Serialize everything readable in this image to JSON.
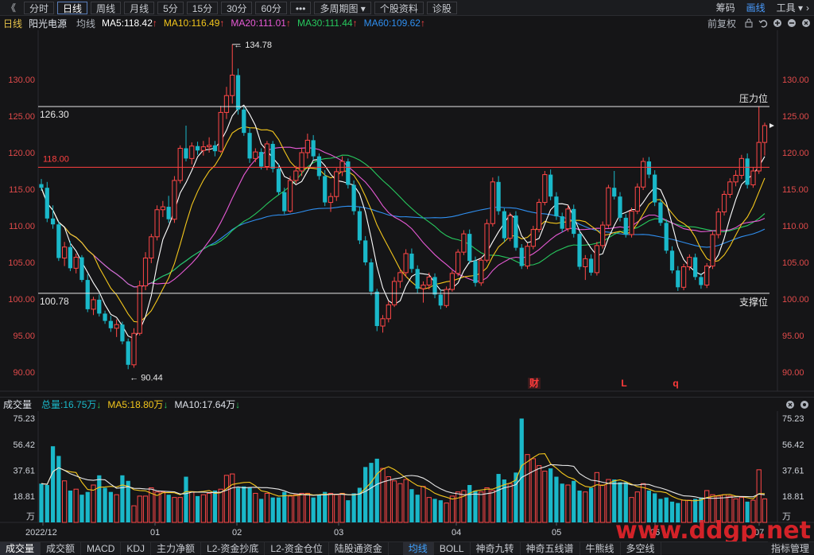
{
  "toolbar": {
    "back": "《",
    "periods": [
      "分时",
      "日线",
      "周线",
      "月线",
      "5分",
      "15分",
      "30分",
      "60分",
      "•••",
      "多周期图 ▾",
      "个股资料",
      "诊股"
    ],
    "active_period": "日线",
    "right": [
      "筹码",
      "画线",
      "工具 ▾"
    ],
    "active_right": "画线"
  },
  "info": {
    "period": "日线",
    "stock_name": "阳光电源",
    "ma_type": "均线",
    "ma5": "MA5:118.42",
    "ma10": "MA10:116.49",
    "ma20": "MA20:111.01",
    "ma30": "MA30:111.44",
    "ma60": "MA60:109.62",
    "adjust": "前复权",
    "ma_colors": {
      "ma5": "#ffffff",
      "ma10": "#f3c61c",
      "ma20": "#e85ad6",
      "ma30": "#27c95e",
      "ma60": "#2f8ff0"
    }
  },
  "price_axis": {
    "labels": [
      "130.00",
      "125.00",
      "120.00",
      "115.00",
      "110.00",
      "105.00",
      "100.00",
      "95.00",
      "90.00"
    ],
    "max_label": "134.78",
    "min_label": "90.44",
    "resistance_value": "126.30",
    "resistance_label": "压力位",
    "support_value": "100.78",
    "support_label": "支撑位",
    "ref_line_value": "118.00",
    "events": [
      "财",
      "L",
      "q"
    ]
  },
  "volume": {
    "title": "成交量",
    "total": "总量:16.75万",
    "ma5": "MA5:18.80万",
    "ma10": "MA10:17.64万",
    "axis_labels": [
      "75.23",
      "56.42",
      "37.61",
      "18.81",
      "万"
    ]
  },
  "date_axis": [
    "2022/12",
    "01",
    "02",
    "03",
    "04",
    "05",
    "06",
    "07"
  ],
  "bottom_tabs": [
    "成交量",
    "成交额",
    "MACD",
    "KDJ",
    "主力净额",
    "L2-资金抄底",
    "L2-资金仓位",
    "陆股通资金",
    "均线",
    "BOLL",
    "神奇九转",
    "神奇五线谱",
    "牛熊线",
    "多空线"
  ],
  "bottom_active": [
    "成交量",
    "均线"
  ],
  "bottom_right": "指标管理",
  "watermark": "www.ddgp.net",
  "colors": {
    "up": "#ff4747",
    "down": "#1ab8c9",
    "grid": "#2b2c30",
    "axis": "#8a8f98"
  },
  "chart_data": {
    "type": "candlestick",
    "title": "阳光电源",
    "y_range": [
      88,
      136
    ],
    "candles": [
      [
        115.7,
        116.4,
        114.8,
        115.2
      ],
      [
        115.2,
        116.0,
        110.5,
        111.0
      ],
      [
        111.0,
        112.8,
        109.6,
        110.2
      ],
      [
        110.2,
        110.6,
        105.2,
        105.6
      ],
      [
        105.6,
        107.8,
        104.5,
        107.1
      ],
      [
        107.1,
        107.9,
        103.8,
        104.2
      ],
      [
        104.2,
        106.2,
        103.5,
        105.7
      ],
      [
        105.7,
        106.0,
        102.3,
        102.6
      ],
      [
        102.6,
        103.4,
        98.2,
        98.6
      ],
      [
        98.6,
        100.3,
        97.8,
        99.9
      ],
      [
        99.9,
        100.6,
        97.6,
        98.0
      ],
      [
        98.0,
        98.4,
        96.6,
        97.0
      ],
      [
        97.0,
        97.7,
        95.5,
        96.0
      ],
      [
        96.0,
        97.2,
        94.8,
        96.5
      ],
      [
        96.5,
        96.9,
        93.8,
        94.2
      ],
      [
        94.2,
        94.6,
        90.4,
        91.0
      ],
      [
        91.0,
        96.0,
        90.6,
        95.3
      ],
      [
        95.3,
        102.5,
        95.0,
        101.8
      ],
      [
        101.8,
        106.4,
        101.2,
        105.6
      ],
      [
        105.6,
        108.9,
        104.9,
        108.5
      ],
      [
        108.5,
        112.8,
        108.0,
        112.2
      ],
      [
        112.2,
        113.4,
        111.2,
        112.6
      ],
      [
        112.6,
        114.1,
        110.4,
        110.9
      ],
      [
        110.9,
        116.8,
        110.4,
        116.2
      ],
      [
        116.2,
        121.0,
        115.8,
        120.6
      ],
      [
        120.6,
        123.7,
        118.8,
        119.2
      ],
      [
        119.2,
        121.4,
        118.4,
        120.9
      ],
      [
        120.9,
        121.5,
        119.7,
        120.3
      ],
      [
        120.3,
        121.6,
        119.6,
        120.8
      ],
      [
        120.8,
        122.1,
        120.0,
        121.0
      ],
      [
        121.0,
        121.6,
        119.5,
        120.2
      ],
      [
        120.2,
        126.4,
        120.0,
        125.5
      ],
      [
        125.5,
        129.0,
        124.6,
        127.8
      ],
      [
        127.8,
        134.8,
        126.7,
        130.6
      ],
      [
        130.6,
        131.5,
        125.2,
        125.9
      ],
      [
        125.9,
        126.3,
        122.3,
        122.7
      ],
      [
        122.7,
        123.4,
        118.6,
        119.2
      ],
      [
        119.2,
        120.6,
        118.7,
        120.1
      ],
      [
        120.1,
        120.6,
        117.7,
        118.1
      ],
      [
        118.1,
        121.6,
        117.6,
        121.2
      ],
      [
        121.2,
        121.6,
        117.3,
        117.8
      ],
      [
        117.8,
        118.5,
        114.2,
        114.6
      ],
      [
        114.6,
        115.2,
        111.6,
        112.0
      ],
      [
        112.0,
        116.8,
        111.8,
        116.2
      ],
      [
        116.2,
        118.2,
        115.8,
        117.5
      ],
      [
        117.5,
        120.7,
        116.8,
        120.0
      ],
      [
        120.0,
        122.6,
        119.2,
        121.7
      ],
      [
        121.7,
        122.4,
        119.0,
        119.5
      ],
      [
        119.5,
        119.9,
        116.3,
        116.8
      ],
      [
        116.8,
        117.6,
        112.7,
        113.2
      ],
      [
        113.2,
        114.5,
        111.9,
        114.0
      ],
      [
        114.0,
        117.9,
        113.4,
        117.4
      ],
      [
        117.4,
        119.5,
        116.8,
        118.8
      ],
      [
        118.8,
        119.2,
        115.1,
        115.6
      ],
      [
        115.6,
        116.2,
        111.5,
        112.0
      ],
      [
        112.0,
        112.6,
        107.5,
        108.0
      ],
      [
        108.0,
        108.6,
        104.6,
        105.0
      ],
      [
        105.0,
        105.5,
        100.5,
        101.0
      ],
      [
        101.0,
        101.4,
        95.6,
        96.3
      ],
      [
        96.3,
        97.8,
        95.4,
        97.3
      ],
      [
        97.3,
        99.7,
        96.8,
        99.2
      ],
      [
        99.2,
        103.0,
        98.9,
        102.4
      ],
      [
        102.4,
        104.1,
        101.5,
        103.6
      ],
      [
        103.6,
        106.8,
        103.0,
        106.2
      ],
      [
        106.2,
        106.9,
        103.6,
        104.1
      ],
      [
        104.1,
        104.6,
        100.8,
        101.4
      ],
      [
        101.4,
        102.4,
        99.5,
        101.9
      ],
      [
        101.9,
        103.6,
        101.3,
        103.0
      ],
      [
        103.0,
        103.5,
        100.1,
        100.6
      ],
      [
        100.6,
        101.3,
        98.6,
        99.1
      ],
      [
        99.1,
        101.7,
        98.8,
        101.3
      ],
      [
        101.3,
        103.9,
        101.0,
        103.5
      ],
      [
        103.5,
        106.8,
        103.1,
        106.4
      ],
      [
        106.4,
        109.4,
        106.0,
        108.9
      ],
      [
        108.9,
        109.5,
        104.8,
        105.2
      ],
      [
        105.2,
        105.8,
        101.7,
        102.2
      ],
      [
        102.2,
        105.7,
        101.8,
        105.3
      ],
      [
        105.3,
        110.9,
        105.0,
        110.3
      ],
      [
        110.3,
        116.6,
        109.9,
        116.0
      ],
      [
        116.0,
        116.8,
        111.5,
        112.0
      ],
      [
        112.0,
        112.4,
        107.8,
        108.3
      ],
      [
        108.3,
        111.8,
        107.9,
        111.4
      ],
      [
        111.4,
        112.0,
        106.6,
        107.0
      ],
      [
        107.0,
        107.5,
        104.1,
        104.5
      ],
      [
        104.5,
        107.6,
        104.1,
        107.2
      ],
      [
        107.2,
        110.0,
        106.8,
        109.5
      ],
      [
        109.5,
        113.7,
        109.1,
        113.2
      ],
      [
        113.2,
        117.5,
        112.8,
        117.0
      ],
      [
        117.0,
        117.7,
        113.5,
        114.0
      ],
      [
        114.0,
        114.6,
        110.8,
        111.3
      ],
      [
        111.3,
        111.8,
        109.1,
        109.6
      ],
      [
        109.6,
        112.8,
        109.2,
        112.3
      ],
      [
        112.3,
        112.9,
        108.4,
        108.9
      ],
      [
        108.9,
        109.3,
        104.0,
        104.4
      ],
      [
        104.4,
        106.0,
        102.6,
        105.5
      ],
      [
        105.5,
        106.1,
        103.2,
        103.6
      ],
      [
        103.6,
        107.8,
        103.2,
        107.3
      ],
      [
        107.3,
        110.6,
        106.9,
        110.1
      ],
      [
        110.1,
        115.6,
        109.7,
        115.2
      ],
      [
        115.2,
        117.5,
        113.6,
        114.0
      ],
      [
        114.0,
        114.6,
        110.6,
        111.1
      ],
      [
        111.1,
        111.6,
        108.4,
        108.8
      ],
      [
        108.8,
        112.5,
        108.4,
        112.0
      ],
      [
        112.0,
        115.8,
        111.6,
        115.3
      ],
      [
        115.3,
        119.3,
        114.9,
        118.8
      ],
      [
        118.8,
        119.4,
        116.5,
        117.0
      ],
      [
        117.0,
        117.6,
        112.7,
        113.2
      ],
      [
        113.2,
        113.7,
        110.0,
        110.4
      ],
      [
        110.4,
        110.9,
        106.2,
        106.6
      ],
      [
        106.6,
        107.2,
        103.5,
        103.9
      ],
      [
        103.9,
        104.5,
        101.1,
        101.6
      ],
      [
        101.6,
        104.8,
        101.2,
        104.4
      ],
      [
        104.4,
        106.1,
        103.9,
        105.7
      ],
      [
        105.7,
        106.2,
        102.6,
        103.0
      ],
      [
        103.0,
        103.5,
        101.4,
        101.9
      ],
      [
        101.9,
        104.9,
        101.5,
        104.5
      ],
      [
        104.5,
        109.2,
        104.1,
        108.8
      ],
      [
        108.8,
        112.4,
        108.3,
        111.9
      ],
      [
        111.9,
        114.8,
        111.4,
        114.3
      ],
      [
        114.3,
        116.5,
        113.8,
        116.0
      ],
      [
        116.0,
        117.6,
        115.4,
        116.9
      ],
      [
        116.9,
        119.7,
        116.4,
        119.2
      ],
      [
        119.2,
        119.9,
        115.1,
        115.6
      ],
      [
        115.6,
        118.0,
        115.2,
        117.5
      ],
      [
        117.5,
        126.3,
        117.1,
        121.4
      ],
      [
        121.4,
        124.1,
        119.6,
        123.7
      ]
    ],
    "volume": [
      28,
      27,
      55,
      48,
      30,
      23,
      24,
      20,
      22,
      27,
      34,
      25,
      22,
      20,
      34,
      30,
      12,
      19,
      19,
      25,
      22,
      22,
      20,
      18,
      18,
      33,
      22,
      19,
      20,
      21,
      23,
      24,
      34,
      35,
      25,
      26,
      25,
      21,
      17,
      21,
      18,
      18,
      22,
      19,
      20,
      21,
      21,
      18,
      20,
      22,
      21,
      20,
      21,
      16,
      21,
      25,
      40,
      43,
      46,
      39,
      33,
      30,
      28,
      31,
      24,
      20,
      26,
      18,
      17,
      16,
      14,
      19,
      22,
      23,
      27,
      23,
      22,
      25,
      23,
      35,
      31,
      28,
      36,
      75,
      49,
      46,
      41,
      37,
      39,
      33,
      28,
      27,
      30,
      23,
      22,
      25,
      36,
      27,
      31,
      31,
      29,
      29,
      18,
      22,
      28,
      23,
      21,
      17,
      18,
      15,
      14,
      16,
      16,
      17,
      18,
      23,
      20,
      19,
      20,
      19,
      17,
      18,
      15,
      16,
      38,
      17
    ],
    "date_ticks": [
      "2022/12",
      "01",
      "02",
      "03",
      "04",
      "05",
      "06",
      "07"
    ],
    "ma5_label": "MA5:118.42",
    "ma10_label": "MA10:116.49",
    "ma20_label": "MA20:111.01",
    "ma30_label": "MA30:111.44",
    "ma60_label": "MA60:109.62",
    "resistance": 126.3,
    "support": 100.78,
    "reference": 118.0,
    "volume_y_ticks": [
      75.23,
      56.42,
      37.61,
      18.81
    ],
    "volume_unit": "万"
  }
}
